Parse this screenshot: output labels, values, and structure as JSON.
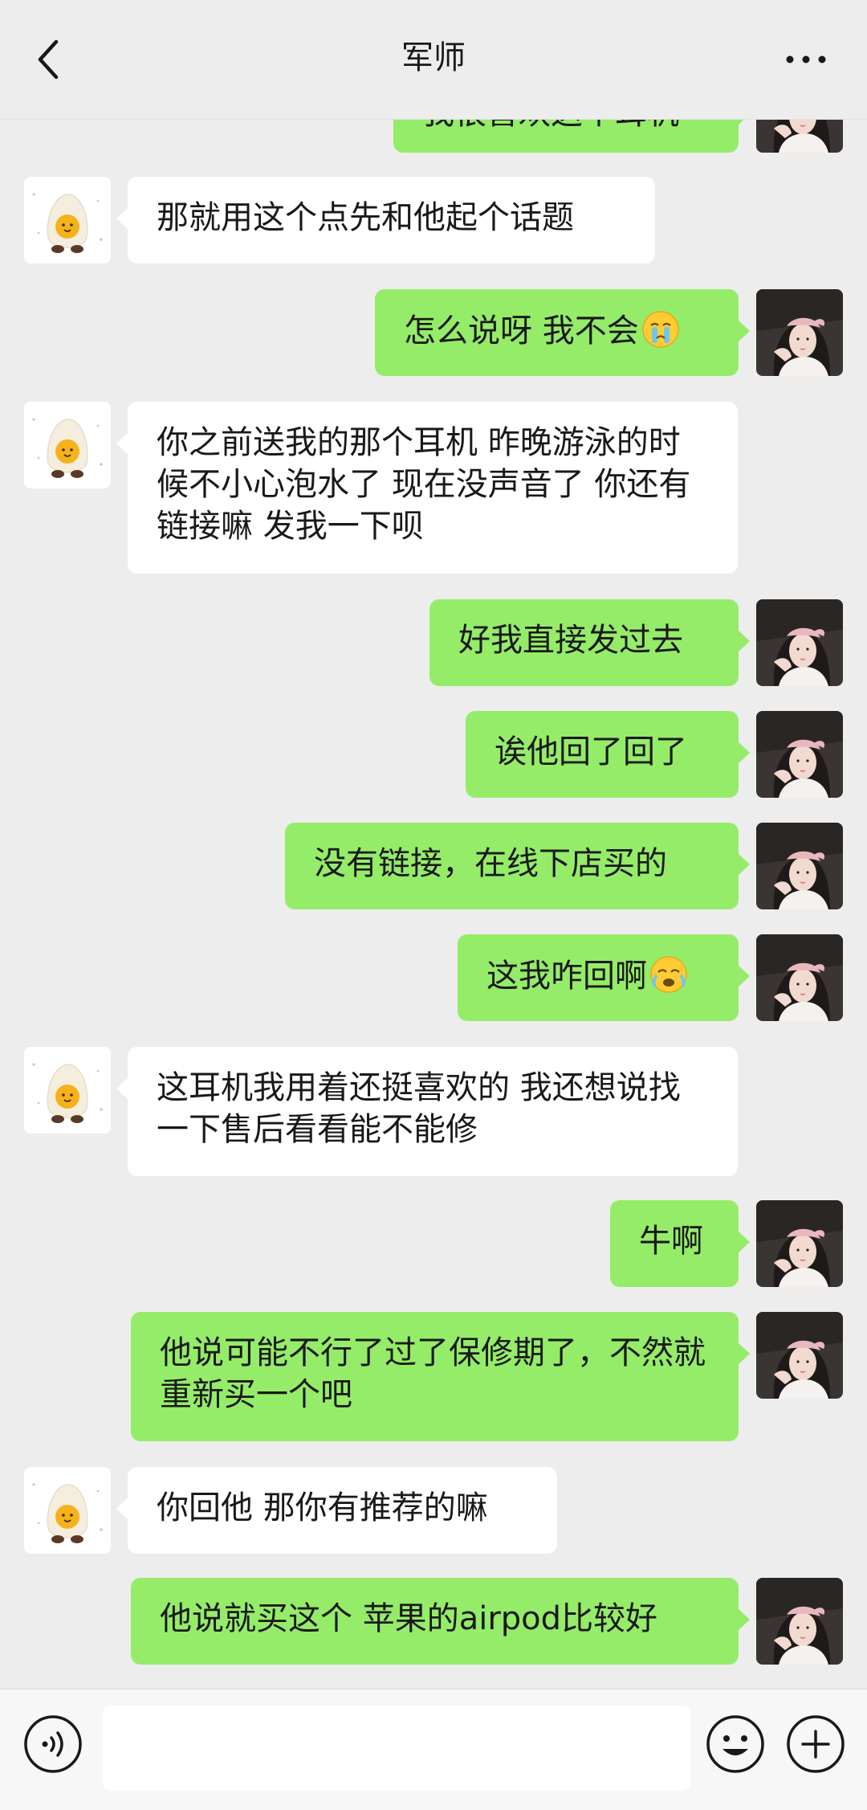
{
  "header": {
    "title": "军师",
    "back_icon": "chevron-left-icon",
    "more_icon": "more-dots-icon"
  },
  "messages": [
    {
      "side": "out",
      "text": "我很喜欢这个耳机",
      "emoji": null
    },
    {
      "side": "in",
      "text": "那就用这个点先和他起个话题",
      "emoji": null
    },
    {
      "side": "out",
      "text": "怎么说呀 我不会",
      "emoji": "crying-face-emoji"
    },
    {
      "side": "in",
      "text": "你之前送我的那个耳机 昨晚游泳的时候不小心泡水了 现在没声音了 你还有链接嘛 发我一下呗",
      "emoji": null
    },
    {
      "side": "out",
      "text": "好我直接发过去",
      "emoji": null
    },
    {
      "side": "out",
      "text": "诶他回了回了",
      "emoji": null
    },
    {
      "side": "out",
      "text": "没有链接，在线下店买的",
      "emoji": null
    },
    {
      "side": "out",
      "text": "这我咋回啊",
      "emoji": "loudly-crying-face-emoji"
    },
    {
      "side": "in",
      "text": "这耳机我用着还挺喜欢的 我还想说找一下售后看看能不能修",
      "emoji": null
    },
    {
      "side": "out",
      "text": "牛啊",
      "emoji": null
    },
    {
      "side": "out",
      "text": "他说可能不行了过了保修期了，不然就重新买一个吧",
      "emoji": null
    },
    {
      "side": "in",
      "text": "你回他 那你有推荐的嘛",
      "emoji": null
    },
    {
      "side": "out",
      "text": "他说就买这个 苹果的airpod比较好",
      "emoji": null
    }
  ],
  "input_bar": {
    "voice_icon": "voice-input-icon",
    "input_value": "",
    "emoji_icon": "emoji-smile-icon",
    "plus_icon": "plus-circle-icon"
  },
  "colors": {
    "background": "#EDEDED",
    "outgoing_bubble": "#95EC69",
    "incoming_bubble": "#FFFFFF",
    "text": "#191919"
  }
}
